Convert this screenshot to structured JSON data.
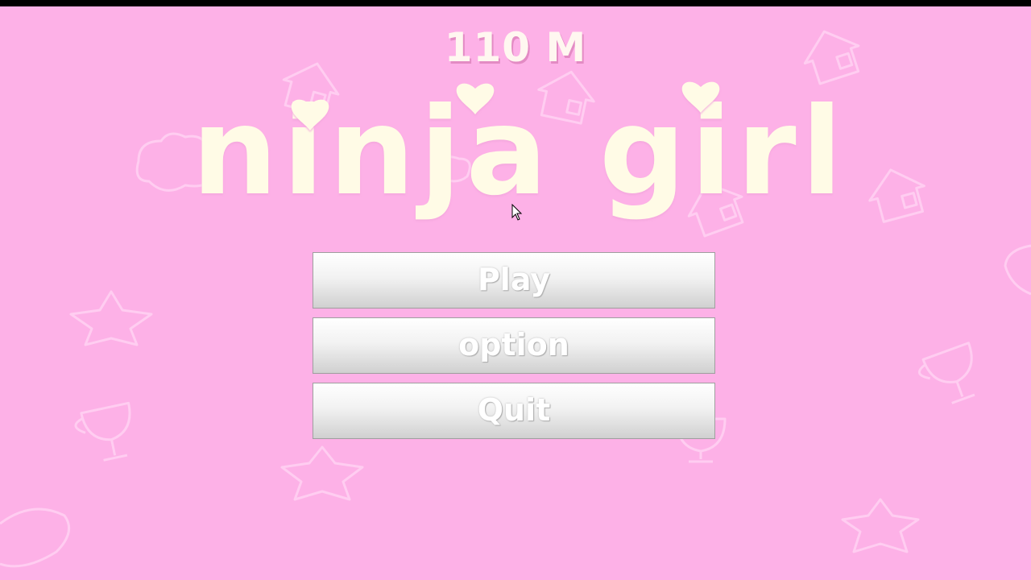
{
  "hud": {
    "distance": "110 M"
  },
  "title": {
    "text": "ninja girl"
  },
  "menu": {
    "play": "Play",
    "option": "option",
    "quit": "Quit"
  },
  "colors": {
    "background": "#fdb1e7",
    "title_fill": "#fffbe6",
    "decor_stroke": "#ffd3f2"
  },
  "decorations": [
    "house-icon",
    "star-icon",
    "trophy-icon",
    "cloud-icon",
    "heart-icon"
  ]
}
